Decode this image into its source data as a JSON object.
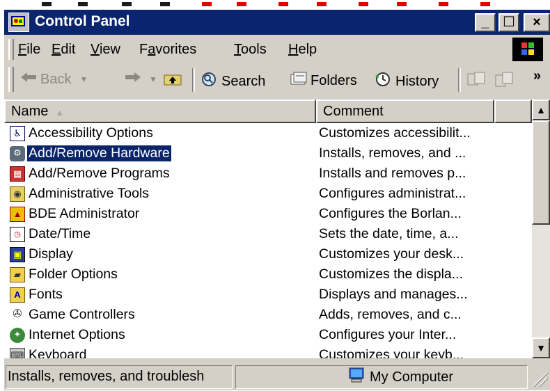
{
  "window": {
    "title": "Control Panel",
    "buttons": {
      "minimize": "_",
      "maximize": "☐",
      "close": "×"
    }
  },
  "menubar": {
    "items": [
      {
        "accel": "F",
        "rest": "ile"
      },
      {
        "accel": "E",
        "rest": "dit"
      },
      {
        "accel": "V",
        "rest": "iew"
      },
      {
        "pre": "F",
        "accel": "a",
        "rest": "vorites"
      },
      {
        "accel": "T",
        "rest": "ools"
      },
      {
        "accel": "H",
        "rest": "elp"
      }
    ]
  },
  "toolbar": {
    "back": "Back",
    "search": "Search",
    "folders": "Folders",
    "history": "History",
    "chevron": "»"
  },
  "list": {
    "columns": {
      "name": "Name",
      "comment": "Comment"
    },
    "rows": [
      {
        "name": "Accessibility Options",
        "comment": "Customizes accessibilit...",
        "icon": "accessibility-icon"
      },
      {
        "name": "Add/Remove Hardware",
        "comment": "Installs, removes, and ...",
        "icon": "hardware-icon",
        "selected": true
      },
      {
        "name": "Add/Remove Programs",
        "comment": "Installs and removes p...",
        "icon": "programs-icon"
      },
      {
        "name": "Administrative Tools",
        "comment": "Configures administrat...",
        "icon": "admin-tools-icon"
      },
      {
        "name": "BDE Administrator",
        "comment": "Configures the Borlan...",
        "icon": "bde-icon"
      },
      {
        "name": "Date/Time",
        "comment": "Sets the date, time, a...",
        "icon": "datetime-icon"
      },
      {
        "name": "Display",
        "comment": "Customizes your desk...",
        "icon": "display-icon"
      },
      {
        "name": "Folder Options",
        "comment": "Customizes the displa...",
        "icon": "folder-options-icon"
      },
      {
        "name": "Fonts",
        "comment": "Displays and manages...",
        "icon": "fonts-icon"
      },
      {
        "name": "Game Controllers",
        "comment": "Adds, removes, and c...",
        "icon": "game-controllers-icon"
      },
      {
        "name": "Internet Options",
        "comment": "Configures your Inter...",
        "icon": "internet-options-icon"
      },
      {
        "name": "Keyboard",
        "comment": "Customizes your keyb...",
        "icon": "keyboard-icon"
      }
    ]
  },
  "statusbar": {
    "description": "Installs, removes, and troublesh",
    "zone": "My Computer"
  }
}
